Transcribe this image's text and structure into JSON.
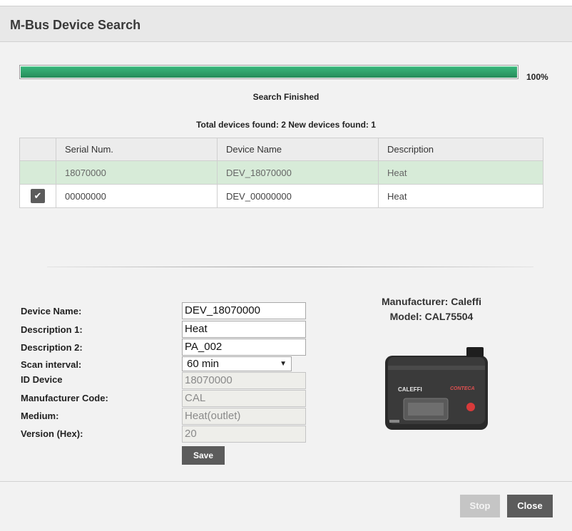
{
  "dialog": {
    "title": "M-Bus Device Search"
  },
  "progress": {
    "value": 1.0,
    "label": "100%"
  },
  "status": "Search Finished",
  "summary": "Total devices found: 2 New devices found: 1",
  "table": {
    "headers": [
      "Serial Num.",
      "Device Name",
      "Description"
    ],
    "rows": [
      {
        "serial": "18070000",
        "name": "DEV_18070000",
        "description": "Heat",
        "selected": true,
        "checked": false
      },
      {
        "serial": "00000000",
        "name": "DEV_00000000",
        "description": "Heat",
        "selected": false,
        "checked": true
      }
    ]
  },
  "form": {
    "device_name_label": "Device Name:",
    "device_name_value": "DEV_18070000",
    "description1_label": "Description 1:",
    "description1_value": "Heat",
    "description2_label": "Description 2:",
    "description2_value": "PA_002",
    "scan_interval_label": "Scan interval:",
    "scan_interval_value": "60 min",
    "id_device_label": "ID Device",
    "id_device_value": "18070000",
    "manufacturer_code_label": "Manufacturer Code:",
    "manufacturer_code_value": "CAL",
    "medium_label": "Medium:",
    "medium_value": "Heat(outlet)",
    "version_label": "Version (Hex):",
    "version_value": "20",
    "save_label": "Save"
  },
  "device_info": {
    "manufacturer": "Manufacturer: Caleffi",
    "model": "Model: CAL75504",
    "image_brand": "CALEFFI",
    "image_product": "CONTECA",
    "icon": "heat-meter-device-image"
  },
  "footer": {
    "stop_label": "Stop",
    "close_label": "Close"
  },
  "colors": {
    "progress": "#2f9f69",
    "selected_row": "#d7ebd8",
    "button_dark": "#5c5c5c",
    "button_disabled": "#c5c5c5"
  }
}
